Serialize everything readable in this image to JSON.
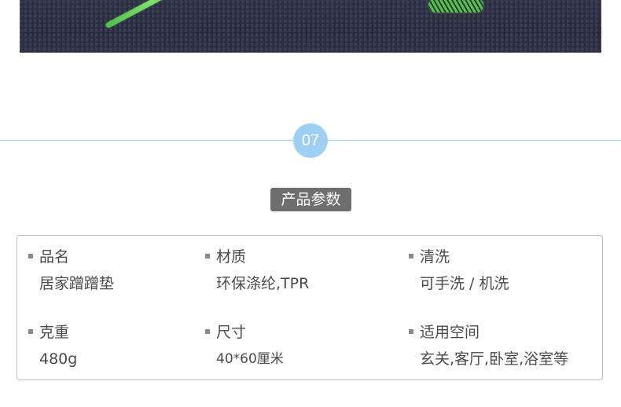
{
  "section": {
    "number": "07",
    "title": "产品参数"
  },
  "specs": [
    {
      "label": "品名",
      "value": "居家蹭蹭垫"
    },
    {
      "label": "材质",
      "value": "环保涤纶,TPR"
    },
    {
      "label": "清洗",
      "value": "可手洗 / 机洗"
    },
    {
      "label": "克重",
      "value": "480g"
    },
    {
      "label": "尺寸",
      "value": "40*60厘米"
    },
    {
      "label": "适用空间",
      "value": "玄关,客厅,卧室,浴室等"
    }
  ],
  "colors": {
    "accent": "#9fd0f3",
    "divider": "#8fc9ec",
    "title_bg": "#6e6e6e",
    "text": "#4a4a4a",
    "border": "#bfbfbf"
  },
  "icons": [
    "bullet-square-icon"
  ]
}
